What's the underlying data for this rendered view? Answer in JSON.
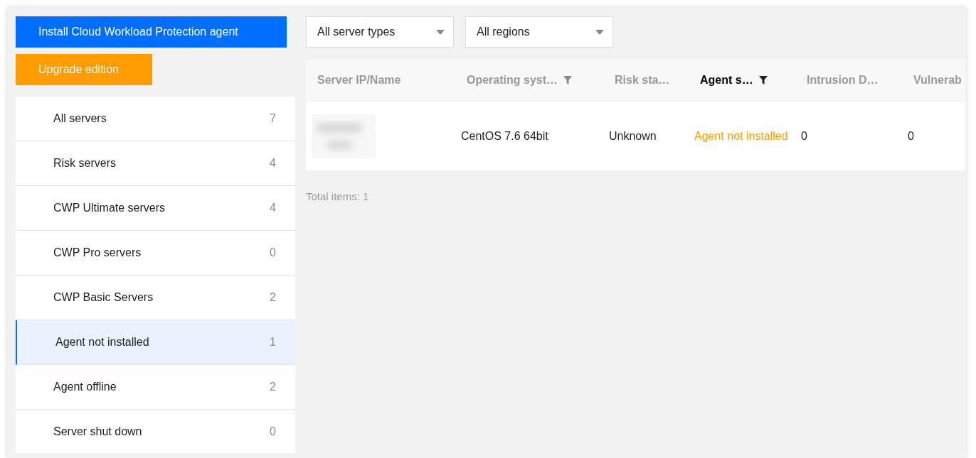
{
  "actions": [
    {
      "label": "Install Cloud Workload Protection agent",
      "kind": "primary"
    },
    {
      "label": "Upgrade edition",
      "kind": "warning"
    }
  ],
  "filters": [
    {
      "value": "All server types"
    },
    {
      "value": "All regions"
    }
  ],
  "sidebar": {
    "items": [
      {
        "label": "All servers",
        "count": "7",
        "selected": false
      },
      {
        "label": "Risk servers",
        "count": "4",
        "selected": false
      },
      {
        "label": "CWP Ultimate servers",
        "count": "4",
        "selected": false
      },
      {
        "label": "CWP Pro servers",
        "count": "0",
        "selected": false
      },
      {
        "label": "CWP Basic Servers",
        "count": "2",
        "selected": false
      },
      {
        "label": "Agent not installed",
        "count": "1",
        "selected": true
      },
      {
        "label": "Agent offline",
        "count": "2",
        "selected": false
      },
      {
        "label": "Server shut down",
        "count": "0",
        "selected": false
      }
    ]
  },
  "table": {
    "columns": [
      {
        "label": "Server IP/Name",
        "filter": false,
        "active": false
      },
      {
        "label": "Operating syst…",
        "filter": true,
        "active": false
      },
      {
        "label": "Risk sta…",
        "filter": false,
        "active": false
      },
      {
        "label": "Agent s…",
        "filter": true,
        "active": true
      },
      {
        "label": "Intrusion D…",
        "filter": false,
        "active": false
      },
      {
        "label": "Vulnerab",
        "active": false
      }
    ],
    "rows": [
      {
        "cells": [
          {
            "kind": "picture"
          },
          {
            "text": "CentOS 7.6 64bit",
            "kind": "plain"
          },
          {
            "text": "Unknown",
            "kind": "plain"
          },
          {
            "text": "Agent not installed",
            "kind": "warning"
          },
          {
            "text": "0",
            "kind": "plain"
          },
          {
            "text": "0",
            "kind": "plain"
          }
        ]
      }
    ]
  },
  "total": "Total items: 1"
}
